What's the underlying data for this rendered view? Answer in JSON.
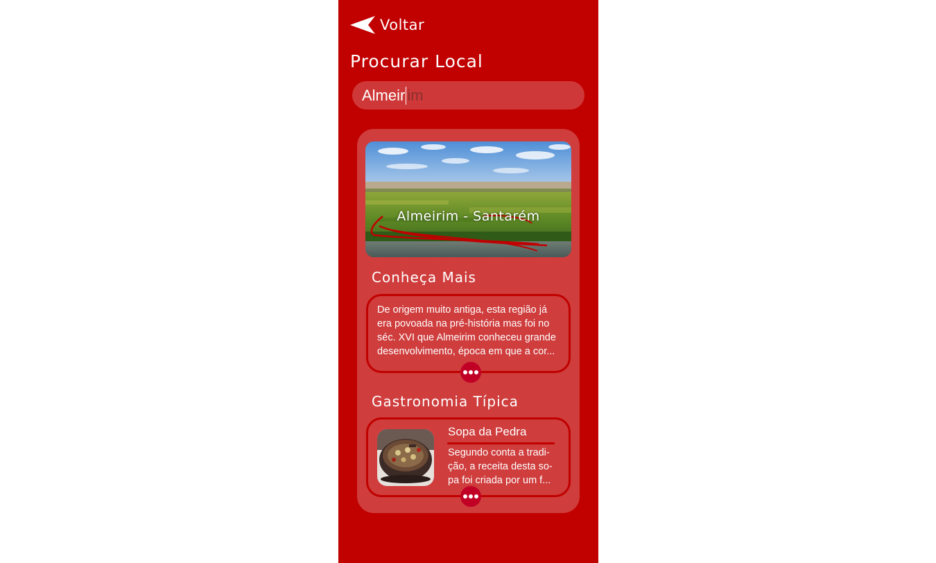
{
  "nav": {
    "back_label": "Voltar"
  },
  "page": {
    "title": "Procurar Local"
  },
  "search": {
    "typed_value": "Almeir",
    "suggestion": "im"
  },
  "place": {
    "title": "Almeirim - Santarém",
    "about": {
      "heading": "Conheça Mais",
      "text": "De origem muito antiga, esta região já era povoada na pré-história mas foi no séc. XVI que Almeirim conheceu grande desenvolvimento, época em que a cor..."
    },
    "gastronomy": {
      "heading": "Gastronomia Típica",
      "dish_name": "Sopa da Pedra",
      "dish_text": "Segundo conta a tradi-ção, a receita desta so-pa foi criada por um f..."
    }
  },
  "icons": {
    "back": "back-arrow-icon",
    "more": "ellipsis-icon"
  },
  "colors": {
    "background": "#c10000",
    "card": "#cf3d3d",
    "search_field": "#cf3838",
    "accent": "#c10025"
  }
}
